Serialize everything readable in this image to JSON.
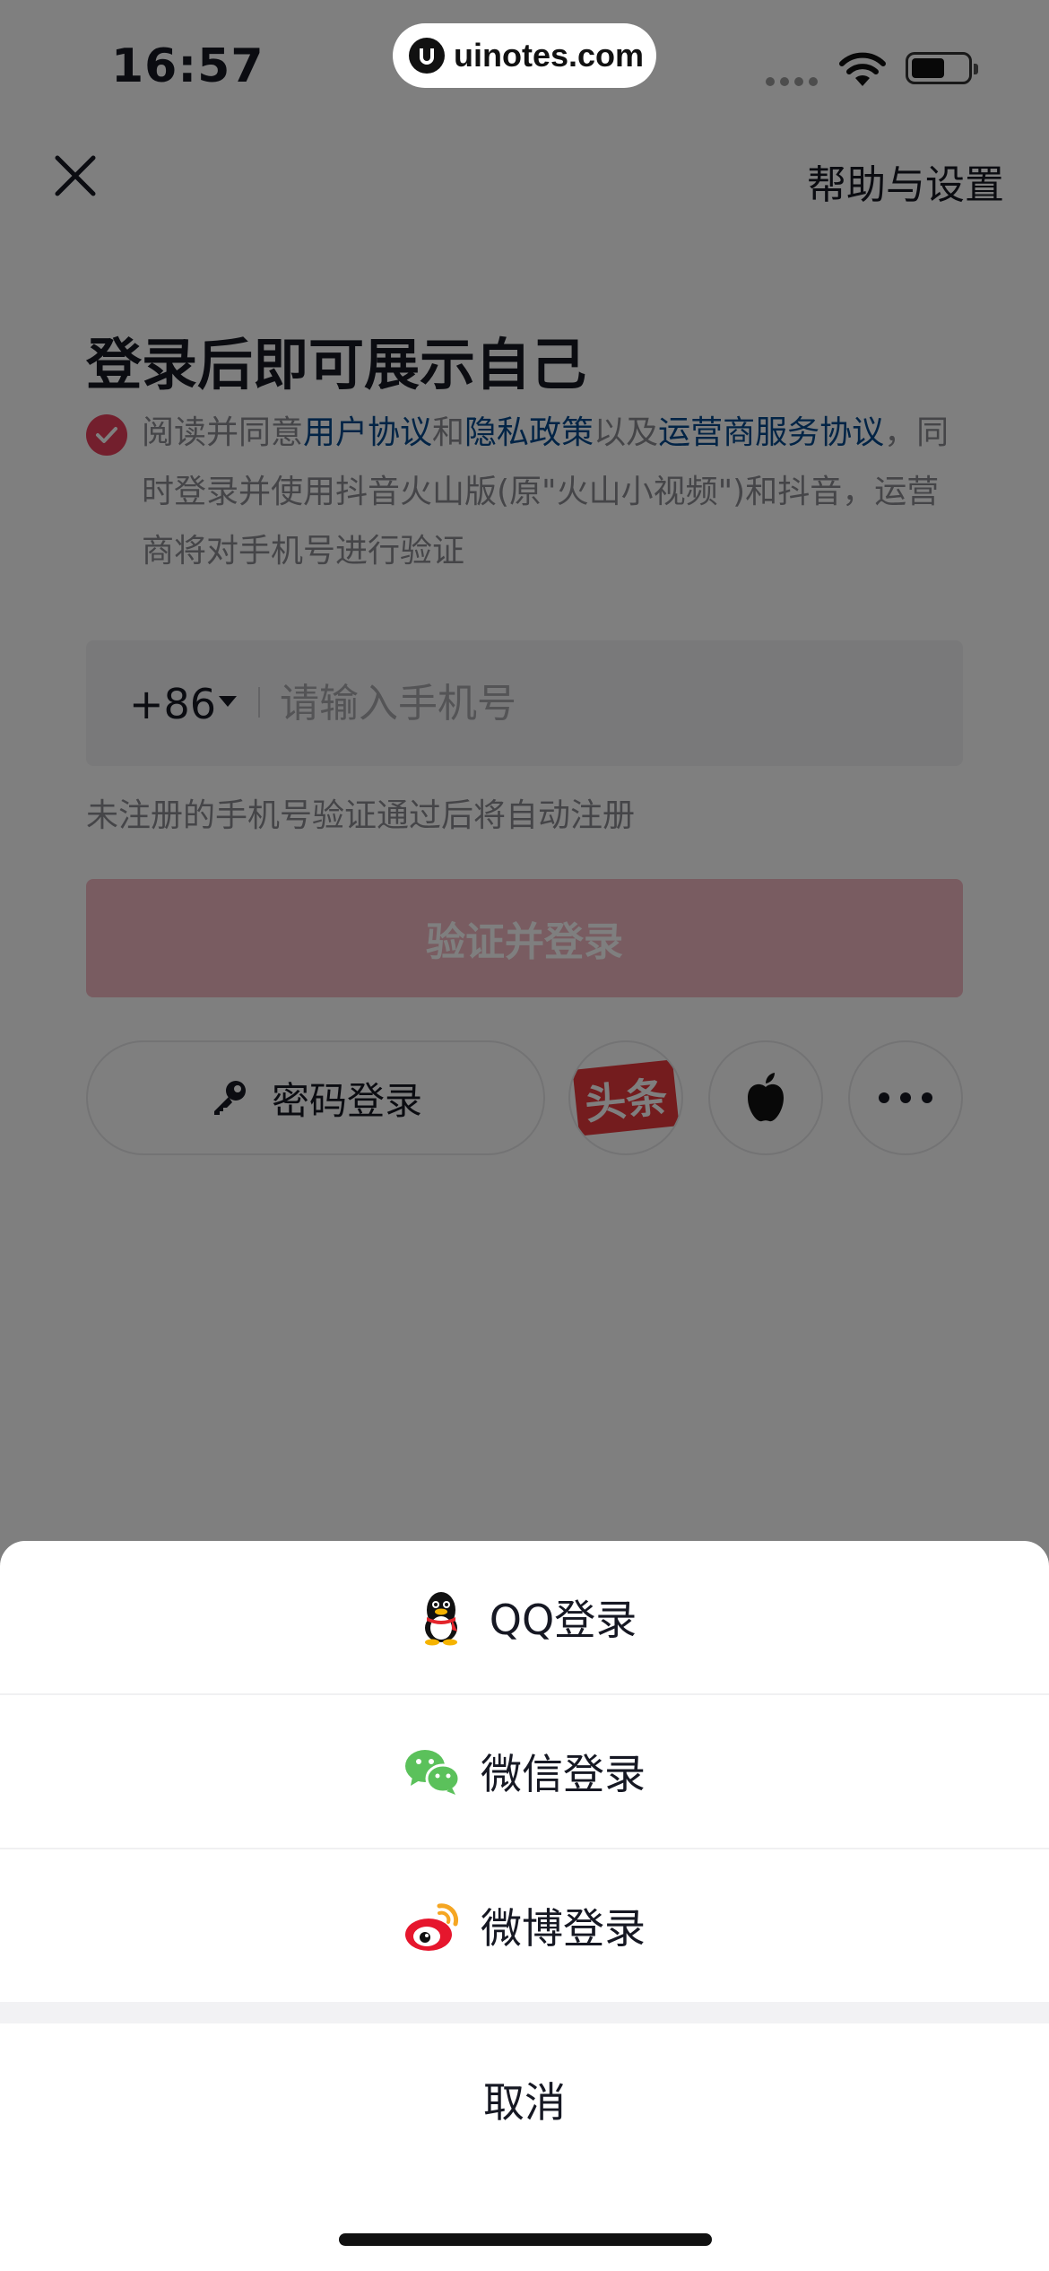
{
  "status_bar": {
    "time": "16:57",
    "watermark": "uinotes.com"
  },
  "header": {
    "help_label": "帮助与设置"
  },
  "login": {
    "title": "登录后即可展示自己",
    "agreement": {
      "prefix": "阅读并同意",
      "user_agreement": "用户协议",
      "and": "和",
      "privacy_policy": "隐私政策",
      "and_also": "以及",
      "carrier_agreement": "运营商服务协议",
      "suffix": "，同时登录并使用抖音火山版(原\"火山小视频\")和抖音，运营商将对手机号进行验证"
    },
    "country_code": "+86",
    "phone_placeholder": "请输入手机号",
    "hint": "未注册的手机号验证通过后将自动注册",
    "submit_label": "验证并登录",
    "password_login_label": "密码登录",
    "toutiao_label": "头条"
  },
  "sheet": {
    "options": [
      {
        "label": "QQ登录",
        "icon": "qq-penguin-icon"
      },
      {
        "label": "微信登录",
        "icon": "wechat-icon"
      },
      {
        "label": "微博登录",
        "icon": "weibo-icon"
      }
    ],
    "cancel_label": "取消"
  }
}
